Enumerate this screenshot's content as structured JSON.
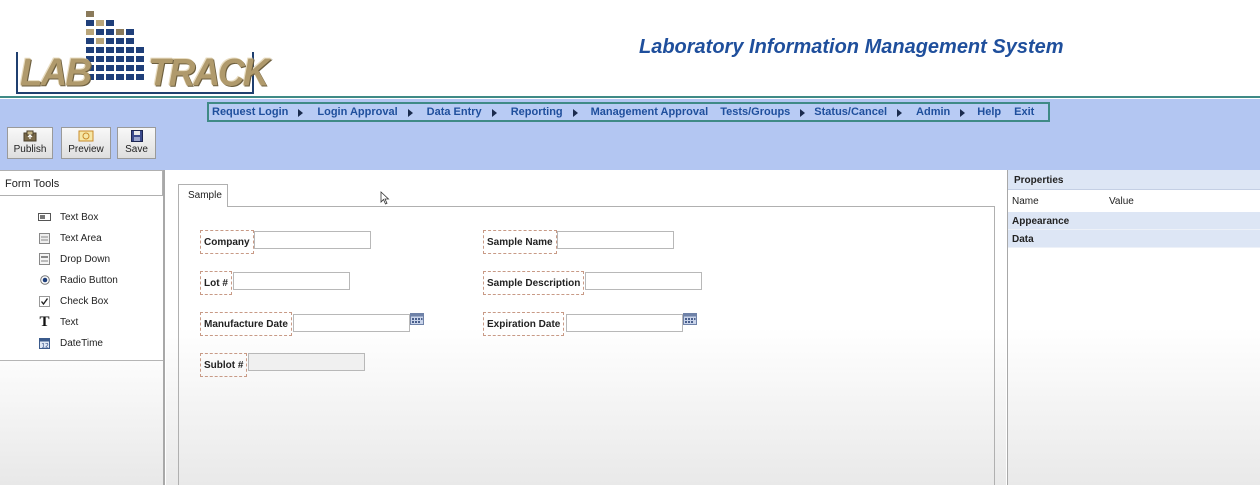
{
  "header": {
    "logo_left": "LAB",
    "logo_right": "TRACK",
    "app_title": "Laboratory Information Management System"
  },
  "menu": [
    {
      "label": "Request Login",
      "arrow": true
    },
    {
      "label": "Login Approval",
      "arrow": true
    },
    {
      "label": "Data Entry",
      "arrow": true
    },
    {
      "label": "Reporting",
      "arrow": true
    },
    {
      "label": "Management Approval",
      "arrow": false
    },
    {
      "label": "Tests/Groups",
      "arrow": true
    },
    {
      "label": "Status/Cancel",
      "arrow": true
    },
    {
      "label": "Admin",
      "arrow": true
    },
    {
      "label": "Help",
      "arrow": false
    },
    {
      "label": "Exit",
      "arrow": false
    }
  ],
  "toolbar": {
    "publish_label": "Publish",
    "preview_label": "Preview",
    "save_label": "Save"
  },
  "form_tools": {
    "title": "Form Tools",
    "items": [
      {
        "label": "Text Box",
        "icon": "textbox-icon"
      },
      {
        "label": "Text Area",
        "icon": "textarea-icon"
      },
      {
        "label": "Drop Down",
        "icon": "dropdown-icon"
      },
      {
        "label": "Radio Button",
        "icon": "radio-icon"
      },
      {
        "label": "Check Box",
        "icon": "checkbox-icon"
      },
      {
        "label": "Text",
        "icon": "text-icon"
      },
      {
        "label": "DateTime",
        "icon": "calendar-icon"
      }
    ]
  },
  "form": {
    "tab_label": "Sample",
    "fields": {
      "company": {
        "label": "Company",
        "value": ""
      },
      "sample_name": {
        "label": "Sample Name",
        "value": ""
      },
      "lot": {
        "label": "Lot #",
        "value": ""
      },
      "sample_description": {
        "label": "Sample Description",
        "value": ""
      },
      "manufacture_date": {
        "label": "Manufacture Date",
        "value": ""
      },
      "expiration_date": {
        "label": "Expiration Date",
        "value": ""
      },
      "sublot": {
        "label": "Sublot #",
        "value": ""
      }
    }
  },
  "properties": {
    "title": "Properties",
    "col_name": "Name",
    "col_value": "Value",
    "groups": [
      "Appearance",
      "Data"
    ]
  },
  "colors": {
    "brand_blue": "#1f4f9c",
    "band": "#b3c6f2",
    "teal_border": "#3f8a86",
    "logo_gold": "#b09a6c"
  }
}
